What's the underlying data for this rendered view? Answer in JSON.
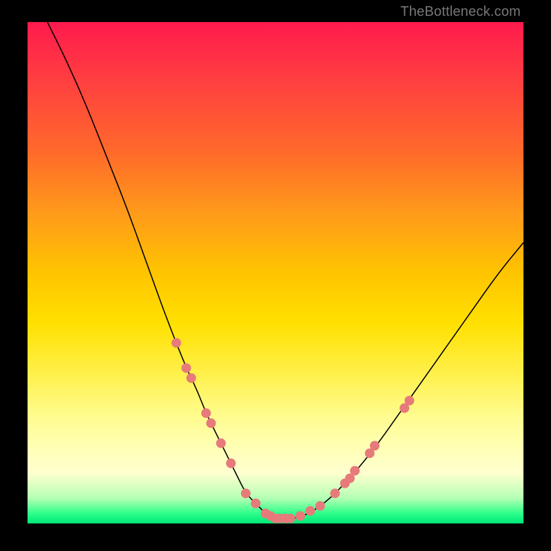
{
  "watermark": "TheBottleneck.com",
  "colors": {
    "frame": "#000000",
    "marker": "#e77a7a",
    "curve": "#000000"
  },
  "chart_data": {
    "type": "line",
    "title": "",
    "xlabel": "",
    "ylabel": "",
    "xlim": [
      0,
      100
    ],
    "ylim": [
      0,
      100
    ],
    "grid": false,
    "series": [
      {
        "name": "bottleneck-curve",
        "x": [
          4,
          8,
          12,
          16,
          20,
          24,
          28,
          32,
          34,
          36,
          38,
          40,
          42,
          44,
          46,
          48,
          50,
          55,
          60,
          65,
          70,
          75,
          80,
          85,
          90,
          95,
          100
        ],
        "y": [
          100,
          92,
          83,
          73,
          63,
          52,
          41,
          31,
          27,
          22,
          18,
          14,
          10,
          6,
          4,
          2,
          1,
          1,
          4,
          9,
          15,
          22,
          29,
          36,
          43,
          50,
          56
        ]
      }
    ],
    "markers": [
      {
        "x": 30,
        "y": 36
      },
      {
        "x": 32,
        "y": 31
      },
      {
        "x": 33,
        "y": 29
      },
      {
        "x": 36,
        "y": 22
      },
      {
        "x": 37,
        "y": 20
      },
      {
        "x": 39,
        "y": 16
      },
      {
        "x": 41,
        "y": 12
      },
      {
        "x": 44,
        "y": 6
      },
      {
        "x": 46,
        "y": 4
      },
      {
        "x": 48,
        "y": 2
      },
      {
        "x": 49,
        "y": 1.5
      },
      {
        "x": 50,
        "y": 1
      },
      {
        "x": 51,
        "y": 1
      },
      {
        "x": 52,
        "y": 1
      },
      {
        "x": 53,
        "y": 1
      },
      {
        "x": 55,
        "y": 1.5
      },
      {
        "x": 57,
        "y": 2.5
      },
      {
        "x": 59,
        "y": 3.5
      },
      {
        "x": 62,
        "y": 6
      },
      {
        "x": 64,
        "y": 8
      },
      {
        "x": 65,
        "y": 9
      },
      {
        "x": 66,
        "y": 10.5
      },
      {
        "x": 69,
        "y": 14
      },
      {
        "x": 70,
        "y": 15.5
      },
      {
        "x": 76,
        "y": 23
      },
      {
        "x": 77,
        "y": 24.5
      }
    ]
  }
}
